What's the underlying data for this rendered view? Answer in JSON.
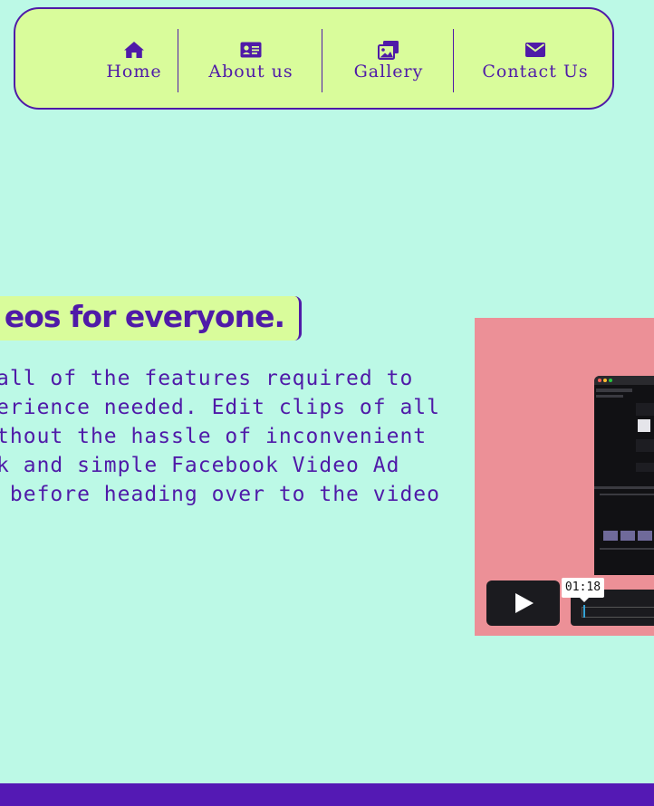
{
  "nav": {
    "items": [
      {
        "label": "Home",
        "icon": "home-icon"
      },
      {
        "label": "About us",
        "icon": "id-card-icon"
      },
      {
        "label": "Gallery",
        "icon": "images-icon"
      },
      {
        "label": "Contact Us",
        "icon": "envelope-icon"
      }
    ]
  },
  "hero": {
    "title": "eos for everyone.",
    "paragraph_lines": [
      "all of the features required to",
      "erience needed. Edit clips of all",
      "thout the hassle of inconvenient",
      "k and simple Facebook Video Ad",
      " before heading over to the video"
    ]
  },
  "video": {
    "time_tooltip": "01:18"
  },
  "colors": {
    "background": "#bcf9e6",
    "nav_bg": "#d9fc9b",
    "accent": "#4f1aa8",
    "video_bg": "#ec9097",
    "footer": "#5419b4"
  }
}
